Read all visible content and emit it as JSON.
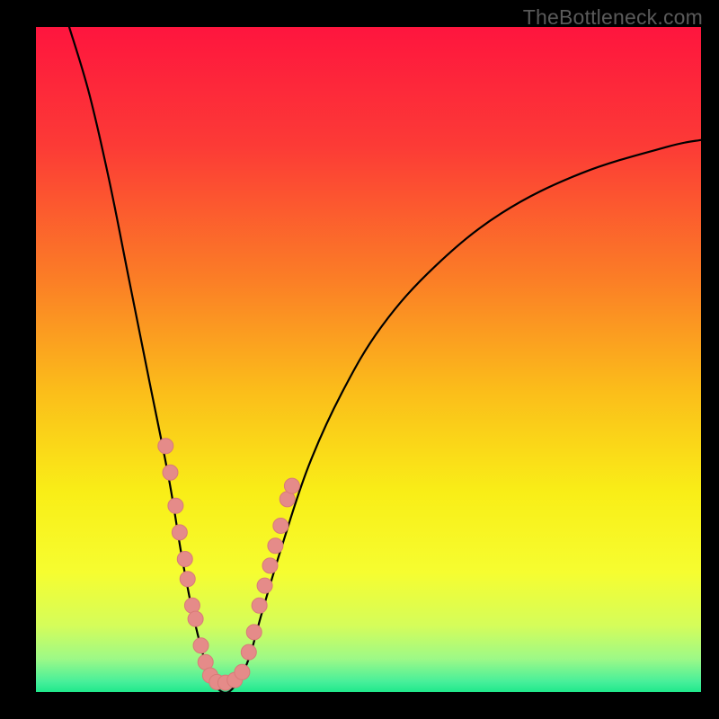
{
  "watermark": "TheBottleneck.com",
  "colors": {
    "frame": "#000000",
    "curve": "#000000",
    "marker_fill": "#e58b89",
    "marker_stroke": "#d87b78",
    "gradient_stops": [
      {
        "offset": 0,
        "color": "#fe153e"
      },
      {
        "offset": 0.18,
        "color": "#fc3b36"
      },
      {
        "offset": 0.38,
        "color": "#fb7e26"
      },
      {
        "offset": 0.55,
        "color": "#fbbe1a"
      },
      {
        "offset": 0.7,
        "color": "#f9ee17"
      },
      {
        "offset": 0.82,
        "color": "#f6fd30"
      },
      {
        "offset": 0.9,
        "color": "#d5fd5a"
      },
      {
        "offset": 0.95,
        "color": "#9df987"
      },
      {
        "offset": 0.985,
        "color": "#46ef9a"
      },
      {
        "offset": 1.0,
        "color": "#1fe88b"
      }
    ]
  },
  "chart_data": {
    "type": "line",
    "title": "",
    "xlabel": "",
    "ylabel": "",
    "xlim": [
      0,
      100
    ],
    "ylim": [
      0,
      100
    ],
    "description": "V-shaped bottleneck curve over rainbow gradient background. Minimum at roughly x≈27 reaching y≈0; left branch rises steeply toward top-left corner; right branch rises and flattens toward upper-right.",
    "series": [
      {
        "name": "bottleneck-curve",
        "points": [
          [
            5,
            100
          ],
          [
            8,
            90
          ],
          [
            11,
            77
          ],
          [
            14,
            62
          ],
          [
            17,
            47
          ],
          [
            20,
            32
          ],
          [
            22,
            20
          ],
          [
            24,
            10
          ],
          [
            26,
            3
          ],
          [
            28,
            0
          ],
          [
            30,
            1
          ],
          [
            32,
            5
          ],
          [
            34,
            12
          ],
          [
            37,
            22
          ],
          [
            41,
            34
          ],
          [
            46,
            45
          ],
          [
            52,
            55
          ],
          [
            60,
            64
          ],
          [
            70,
            72
          ],
          [
            82,
            78
          ],
          [
            95,
            82
          ],
          [
            100,
            83
          ]
        ]
      }
    ],
    "markers": {
      "name": "nearby-configurations",
      "points": [
        [
          19.5,
          37
        ],
        [
          20.2,
          33
        ],
        [
          21.0,
          28
        ],
        [
          21.6,
          24
        ],
        [
          22.4,
          20
        ],
        [
          22.8,
          17
        ],
        [
          23.5,
          13
        ],
        [
          24.0,
          11
        ],
        [
          24.8,
          7
        ],
        [
          25.5,
          4.5
        ],
        [
          26.2,
          2.5
        ],
        [
          27.2,
          1.5
        ],
        [
          28.5,
          1.4
        ],
        [
          29.9,
          1.8
        ],
        [
          31.0,
          3
        ],
        [
          32.0,
          6
        ],
        [
          32.8,
          9
        ],
        [
          33.6,
          13
        ],
        [
          34.4,
          16
        ],
        [
          35.2,
          19
        ],
        [
          36.0,
          22
        ],
        [
          36.8,
          25
        ],
        [
          37.8,
          29
        ],
        [
          38.5,
          31
        ]
      ]
    }
  }
}
